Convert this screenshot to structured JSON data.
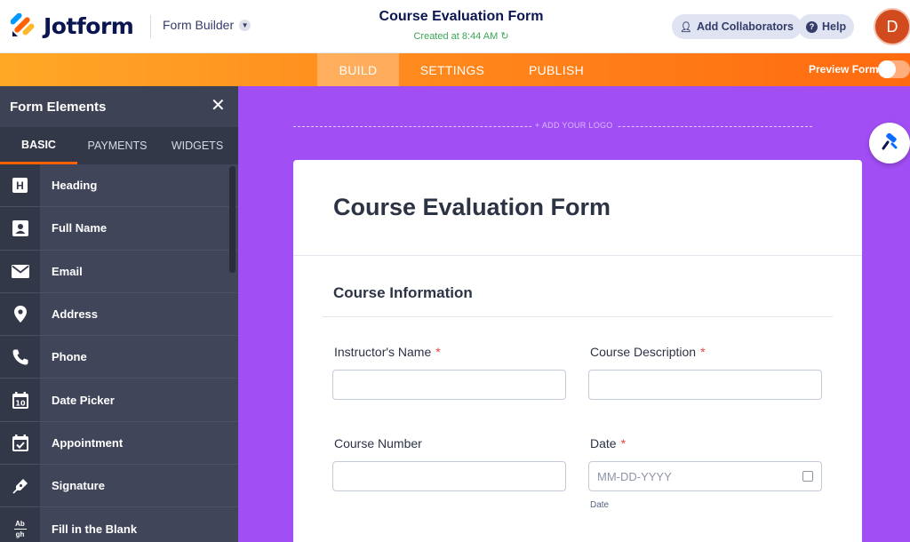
{
  "header": {
    "brand": "Jotform",
    "builder_menu": "Form Builder",
    "form_title": "Course Evaluation Form",
    "created": "Created at 8:44 AM",
    "add_collaborators": "Add Collaborators",
    "help": "Help",
    "avatar_initial": "D"
  },
  "nav": {
    "tabs": [
      "BUILD",
      "SETTINGS",
      "PUBLISH"
    ],
    "active_tab": "BUILD",
    "preview_label": "Preview Form",
    "preview_on": false
  },
  "sidebar": {
    "title": "Form Elements",
    "tabs": [
      "BASIC",
      "PAYMENTS",
      "WIDGETS"
    ],
    "active_tab": "BASIC",
    "items": [
      {
        "label": "Heading",
        "icon": "heading-icon"
      },
      {
        "label": "Full Name",
        "icon": "person-card-icon"
      },
      {
        "label": "Email",
        "icon": "envelope-icon"
      },
      {
        "label": "Address",
        "icon": "map-pin-icon"
      },
      {
        "label": "Phone",
        "icon": "phone-icon"
      },
      {
        "label": "Date Picker",
        "icon": "calendar-icon"
      },
      {
        "label": "Appointment",
        "icon": "calendar-check-icon"
      },
      {
        "label": "Signature",
        "icon": "pen-nib-icon"
      },
      {
        "label": "Fill in the Blank",
        "icon": "fill-blank-icon"
      }
    ],
    "fill_blank_icon_text": [
      "Ab",
      "gh"
    ]
  },
  "canvas": {
    "logo_placeholder": "+ ADD YOUR LOGO",
    "form_title": "Course Evaluation Form",
    "section_title": "Course Information",
    "fields": {
      "instructor_name": {
        "label": "Instructor's Name",
        "required": "*"
      },
      "course_description": {
        "label": "Course Description",
        "required": "*"
      },
      "course_number": {
        "label": "Course Number"
      },
      "date": {
        "label": "Date",
        "required": "*",
        "placeholder": "MM-DD-YYYY",
        "sublabel": "Date"
      }
    }
  },
  "colors": {
    "brand_navy": "#0a1551",
    "nav_orange": "#ff8a1d",
    "canvas_purple": "#a24ef5",
    "sidebar": "#404559",
    "accent": "#ff6100"
  }
}
